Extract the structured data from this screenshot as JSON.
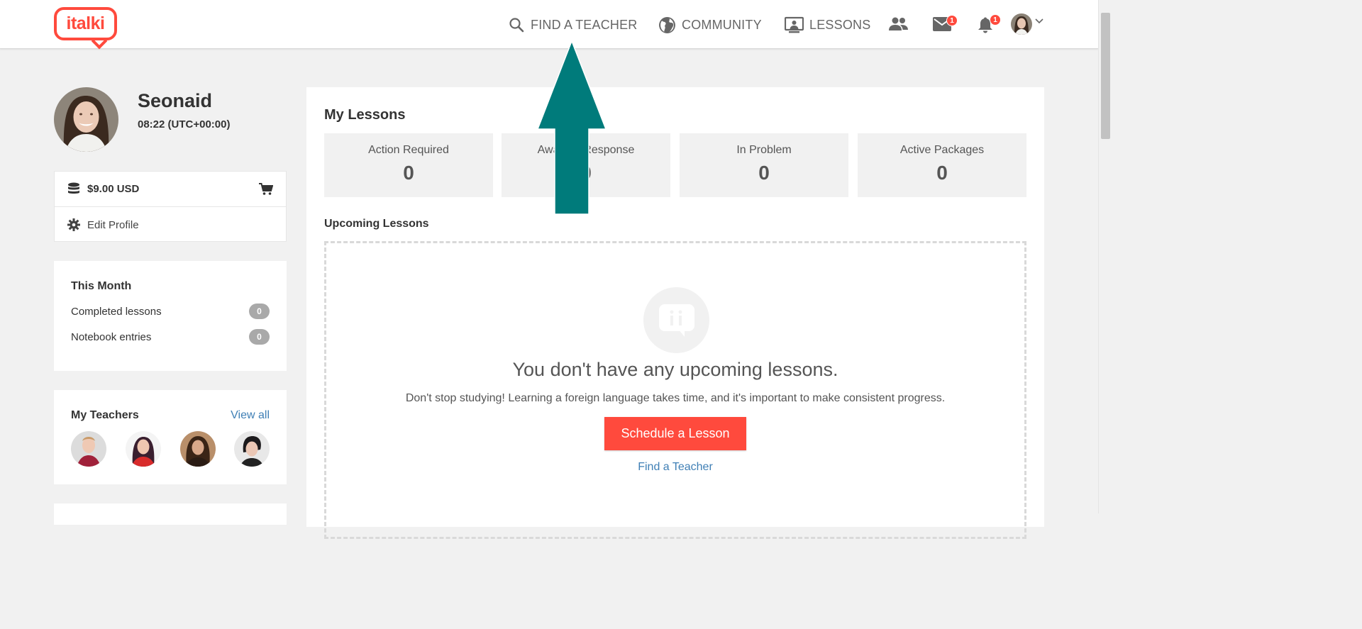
{
  "nav": {
    "logo_text": "italki",
    "find_teacher": "FIND A TEACHER",
    "community": "COMMUNITY",
    "lessons": "LESSONS",
    "messages_badge": "1",
    "notifications_badge": "1"
  },
  "profile": {
    "name": "Seonaid",
    "time": "08:22 (UTC+00:00)"
  },
  "wallet": {
    "balance": "$9.00 USD",
    "edit_profile": "Edit Profile"
  },
  "this_month": {
    "title": "This Month",
    "items": [
      {
        "label": "Completed lessons",
        "count": "0"
      },
      {
        "label": "Notebook entries",
        "count": "0"
      }
    ]
  },
  "my_teachers": {
    "title": "My Teachers",
    "view_all": "View all"
  },
  "lessons": {
    "title": "My Lessons",
    "stats": [
      {
        "label": "Action Required",
        "value": "0"
      },
      {
        "label": "Awaiting Response",
        "value": "0"
      },
      {
        "label": "In Problem",
        "value": "0"
      },
      {
        "label": "Active Packages",
        "value": "0"
      }
    ],
    "upcoming_title": "Upcoming Lessons",
    "empty_heading": "You don't have any upcoming lessons.",
    "empty_text": "Don't stop studying! Learning a foreign language takes time, and it's important to make consistent progress.",
    "schedule_button": "Schedule a Lesson",
    "find_teacher_link": "Find a Teacher"
  },
  "colors": {
    "brand": "#ff4a3d",
    "link": "#3f7fb5",
    "arrow": "#007b7b"
  }
}
